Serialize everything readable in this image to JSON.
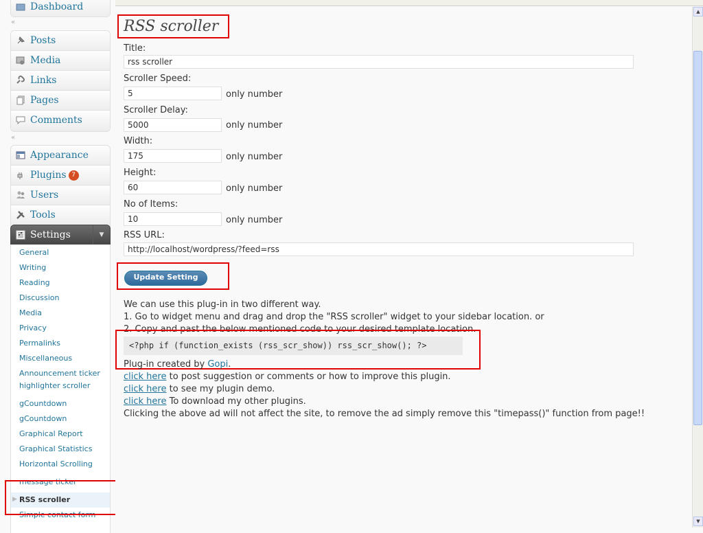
{
  "sidebar": {
    "dashboard": "Dashboard",
    "group1": [
      {
        "label": "Posts",
        "icon": "pushpin-icon"
      },
      {
        "label": "Media",
        "icon": "media-icon"
      },
      {
        "label": "Links",
        "icon": "link-icon"
      },
      {
        "label": "Pages",
        "icon": "pages-icon"
      },
      {
        "label": "Comments",
        "icon": "comments-icon"
      }
    ],
    "group2": [
      {
        "label": "Appearance",
        "icon": "appearance-icon"
      },
      {
        "label": "Plugins",
        "icon": "plugins-icon",
        "badge": "7"
      },
      {
        "label": "Users",
        "icon": "users-icon"
      },
      {
        "label": "Tools",
        "icon": "tools-icon"
      }
    ],
    "settings_label": "Settings",
    "settings_submenu": [
      "General",
      "Writing",
      "Reading",
      "Discussion",
      "Media",
      "Privacy",
      "Permalinks",
      "Miscellaneous",
      "Announcement ticker",
      "highlighter scroller",
      "gCountdown",
      "gCountdown",
      "Graphical Report",
      "Graphical Statistics",
      "Horizontal Scrolling",
      "message ticker",
      "RSS scroller",
      "Simple contact form"
    ],
    "current_item": "RSS scroller"
  },
  "main": {
    "title": "RSS scroller",
    "title_label": "Title:",
    "title_value": "rss scroller",
    "speed_label": "Scroller Speed:",
    "speed_value": "5",
    "delay_label": "Scroller Delay:",
    "delay_value": "5000",
    "width_label": "Width:",
    "width_value": "175",
    "height_label": "Height:",
    "height_value": "60",
    "items_label": "No of Items:",
    "items_value": "10",
    "url_label": "RSS URL:",
    "url_value": "http://localhost/wordpress/?feed=rss",
    "only_number": "only number",
    "update_button": "Update Setting",
    "info_line1": "We can use this plug-in in two different way.",
    "info_line2": "1. Go to widget menu and drag and drop the \"RSS scroller\" widget to your sidebar location. or",
    "info_line3": "2. Copy and past the below mentioned code to your desired template location.",
    "code": "<?php if (function_exists (rss_scr_show)) rss_scr_show(); ?>",
    "created_by": "Plug-in created by ",
    "author": "Gopi",
    "author_suffix": ".",
    "click_here": "click here",
    "suggestion_text": " to post suggestion or comments or how to improve this plugin.",
    "demo_text": " to see my plugin demo.",
    "download_text": " To download my other plugins.",
    "ad_note": "Clicking the above ad will not affect the site, to remove the ad simply remove this \"timepass()\" function from page!!"
  },
  "colors": {
    "link": "#21759b",
    "highlight_box": "#e00000",
    "badge": "#d54e21"
  }
}
